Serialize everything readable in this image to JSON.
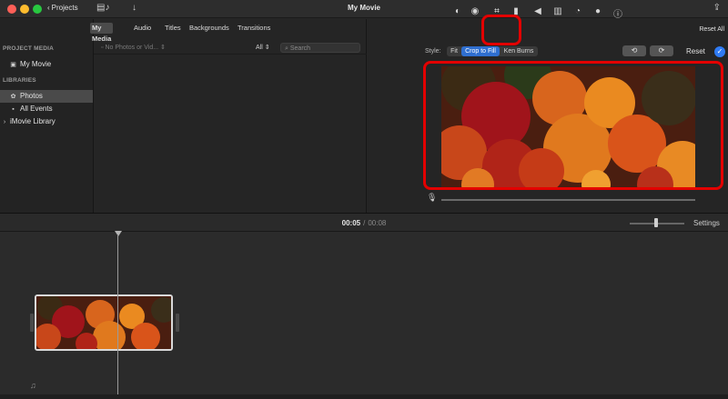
{
  "window": {
    "title": "My Movie",
    "projects_label": "Projects"
  },
  "sidebar": {
    "project_media_header": "PROJECT MEDIA",
    "project_item": "My Movie",
    "libraries_header": "LIBRARIES",
    "items": [
      {
        "label": "Photos",
        "icon": "photos-icon",
        "active": true
      },
      {
        "label": "All Events",
        "icon": "events-icon",
        "active": false
      },
      {
        "label": "iMovie Library",
        "icon": "chevron-right-icon",
        "active": false
      }
    ]
  },
  "media_browser": {
    "tabs": [
      "My Media",
      "Audio",
      "Titles",
      "Backgrounds",
      "Transitions"
    ],
    "active_tab": "My Media",
    "filter_placeholder": "No Photos or Vid...",
    "all_label": "All",
    "search_placeholder": "Search"
  },
  "viewer": {
    "reset_all": "Reset All",
    "style_label": "Style:",
    "style_options": [
      "Fit",
      "Crop to Fill",
      "Ken Burns"
    ],
    "selected_style": "Crop to Fill",
    "reset_label": "Reset",
    "tools": [
      "color-balance-icon",
      "color-correction-icon",
      "crop-icon",
      "stabilization-icon",
      "volume-icon",
      "equalizer-icon",
      "speed-icon",
      "noise-reduction-icon",
      "info-icon"
    ],
    "active_tool": "crop-icon",
    "highlight_color": "#e30000"
  },
  "timeline": {
    "current_time": "00:05",
    "separator": "/",
    "total_time": "00:08",
    "settings_label": "Settings"
  },
  "colors": {
    "accent_blue": "#2f6fd0",
    "annotation_red": "#e30000"
  }
}
